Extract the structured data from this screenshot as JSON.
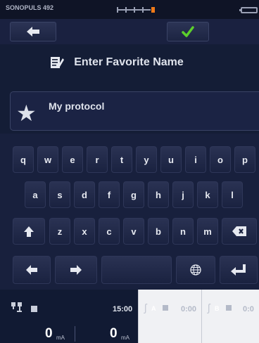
{
  "status": {
    "device": "SONOPULS 492"
  },
  "title": "Enter Favorite Name",
  "name_field": {
    "value": "My protocol"
  },
  "keyboard": {
    "row1": [
      "q",
      "w",
      "e",
      "r",
      "t",
      "y",
      "u",
      "i",
      "o",
      "p"
    ],
    "row2": [
      "a",
      "s",
      "d",
      "f",
      "g",
      "h",
      "j",
      "k",
      "l"
    ],
    "row3": [
      "z",
      "x",
      "c",
      "v",
      "b",
      "n",
      "m"
    ]
  },
  "bottom": {
    "timer": "15:00",
    "mA_left": "0",
    "mA_right": "0",
    "unit": "mA",
    "channel_a": {
      "letter": "A",
      "time": "0:00"
    },
    "channel_b": {
      "letter": "B",
      "time": "0:0"
    }
  },
  "colors": {
    "background": "#141d36",
    "confirm": "#5ccf2b",
    "stepper_active": "#f07a18"
  },
  "icons": [
    "back-arrow-icon",
    "checkmark-icon",
    "edit-note-icon",
    "star-icon",
    "shift-icon",
    "backspace-icon",
    "arrow-left-icon",
    "arrow-right-icon",
    "globe-icon",
    "enter-icon",
    "channel-icon",
    "electrode-icon"
  ]
}
